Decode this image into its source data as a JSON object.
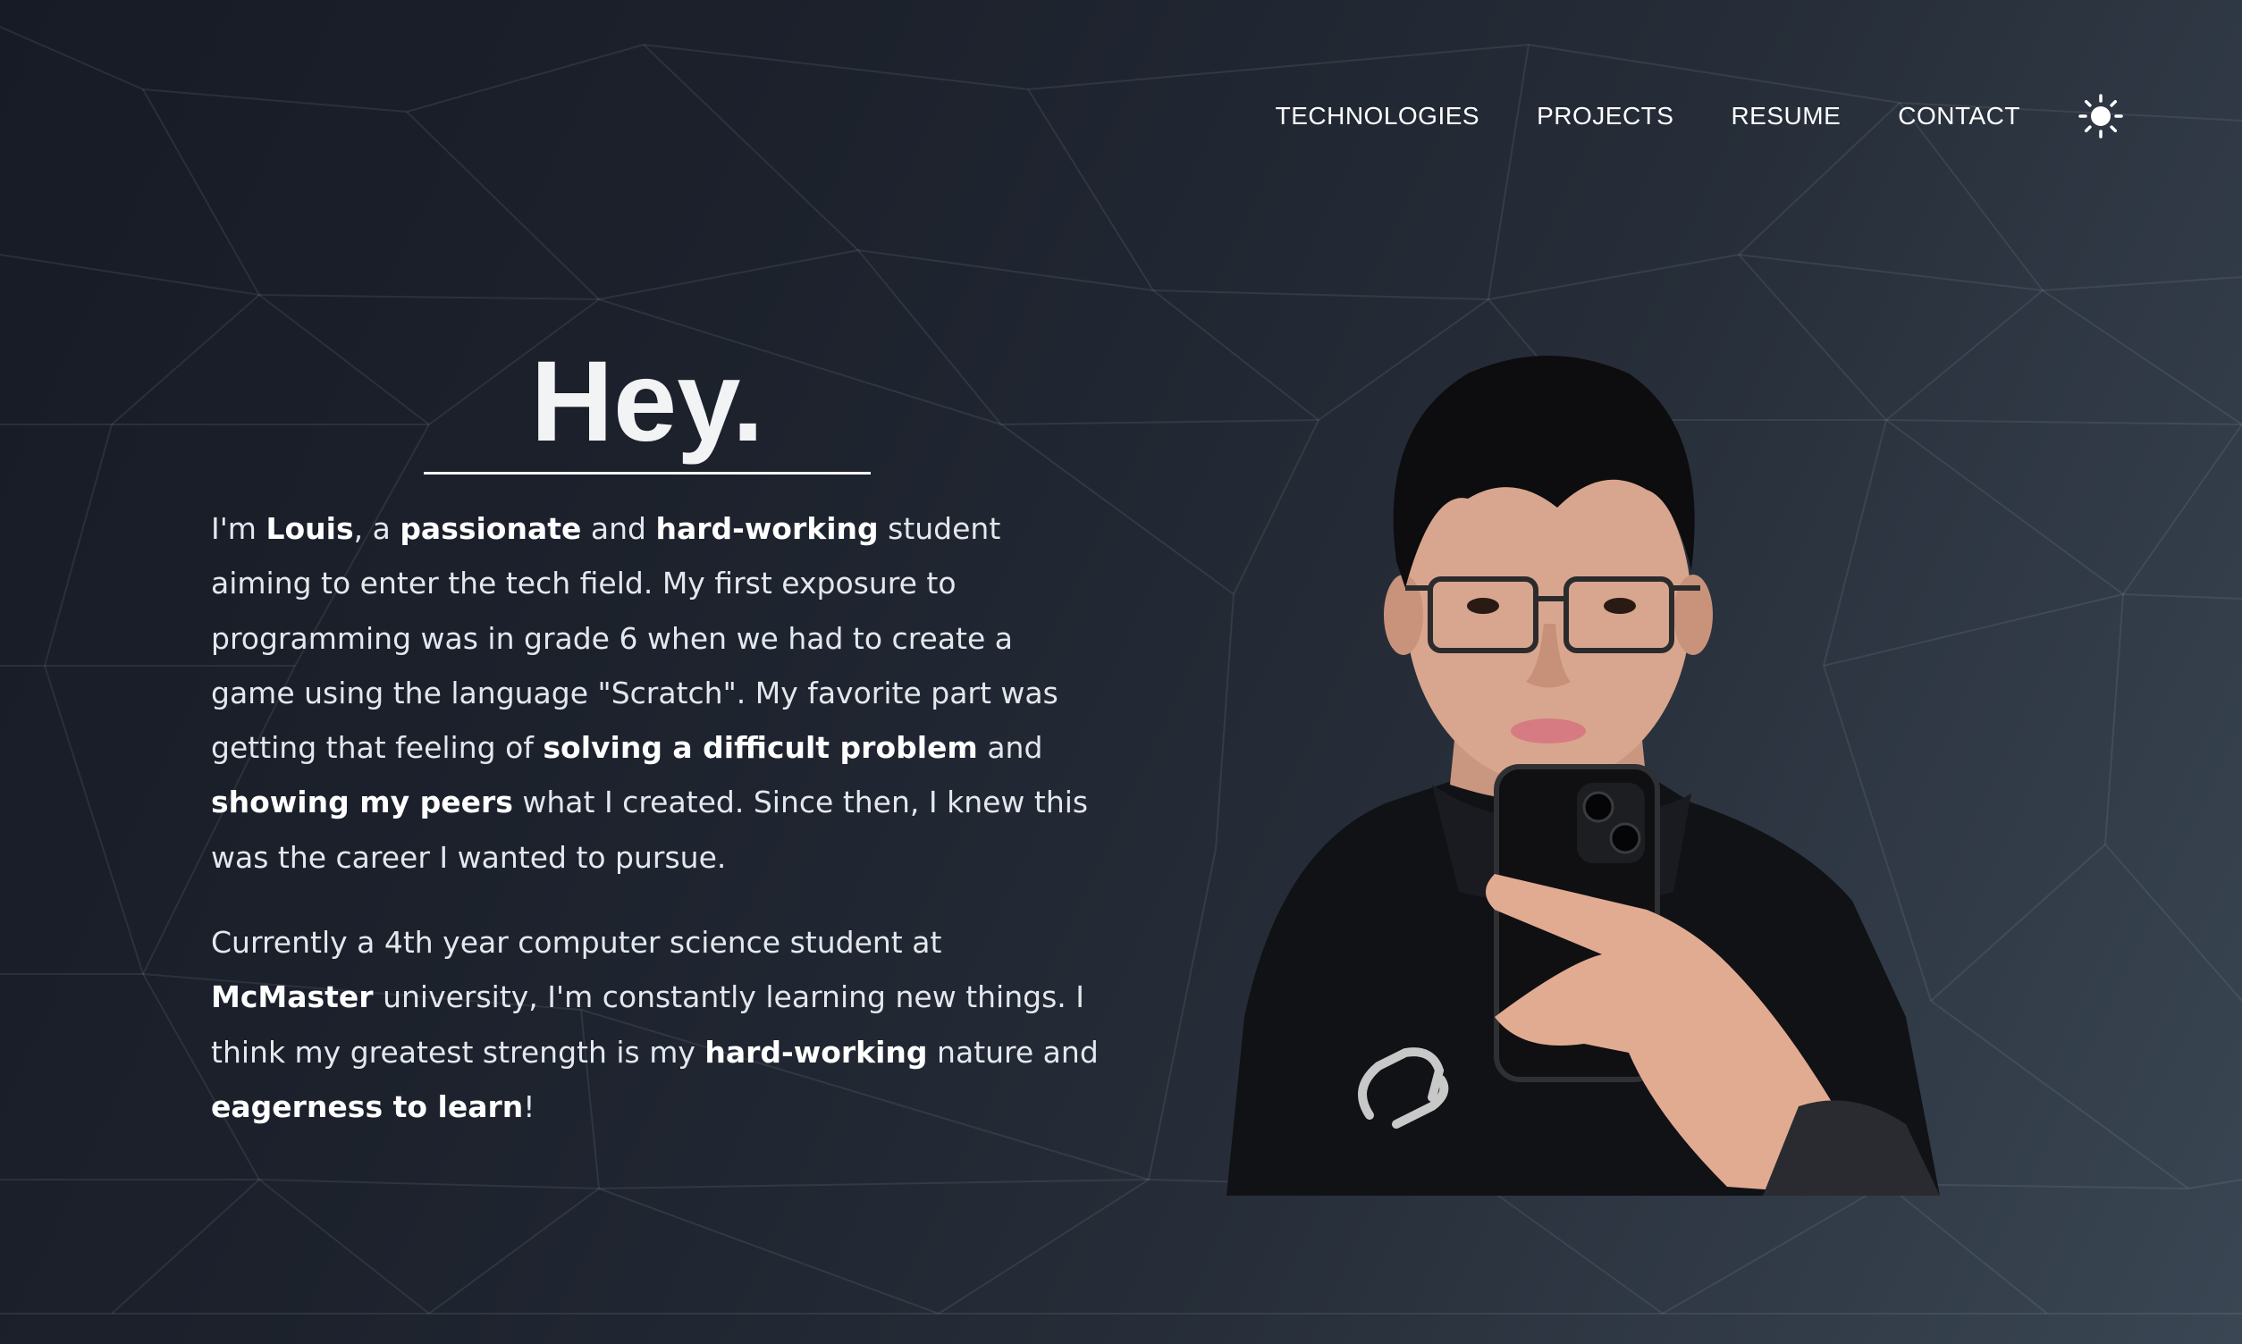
{
  "nav": {
    "items": [
      {
        "label": "TECHNOLOGIES"
      },
      {
        "label": "PROJECTS"
      },
      {
        "label": "RESUME"
      },
      {
        "label": "CONTACT"
      }
    ],
    "theme_toggle_icon": "sun-icon"
  },
  "hero": {
    "title": "Hey.",
    "paragraph1": [
      {
        "text": "I'm "
      },
      {
        "text": "Louis",
        "bold": true
      },
      {
        "text": ", a "
      },
      {
        "text": "passionate",
        "bold": true
      },
      {
        "text": " and "
      },
      {
        "text": "hard-working",
        "bold": true
      },
      {
        "text": " student aiming to enter the tech field. My first exposure to programming was in grade 6 when we had to create a game using the language \"Scratch\". My favorite part was getting that feeling of "
      },
      {
        "text": "solving a difficult problem",
        "bold": true
      },
      {
        "text": " and "
      },
      {
        "text": "showing my peers",
        "bold": true
      },
      {
        "text": " what I created. Since then, I knew this was the career I wanted to pursue."
      }
    ],
    "paragraph2": [
      {
        "text": "Currently a 4th year computer science student at "
      },
      {
        "text": "McMaster",
        "bold": true
      },
      {
        "text": " university, I'm constantly learning new things. I think my greatest strength is my "
      },
      {
        "text": "hard-working",
        "bold": true
      },
      {
        "text": " nature and "
      },
      {
        "text": "eagerness to learn",
        "bold": true
      },
      {
        "text": "!"
      }
    ]
  },
  "photo": {
    "subject": "portrait-photo"
  },
  "colors": {
    "background_dark": "#171b25",
    "background_light": "#3a4653",
    "text": "#eef0f3",
    "accent_white": "#ffffff"
  }
}
